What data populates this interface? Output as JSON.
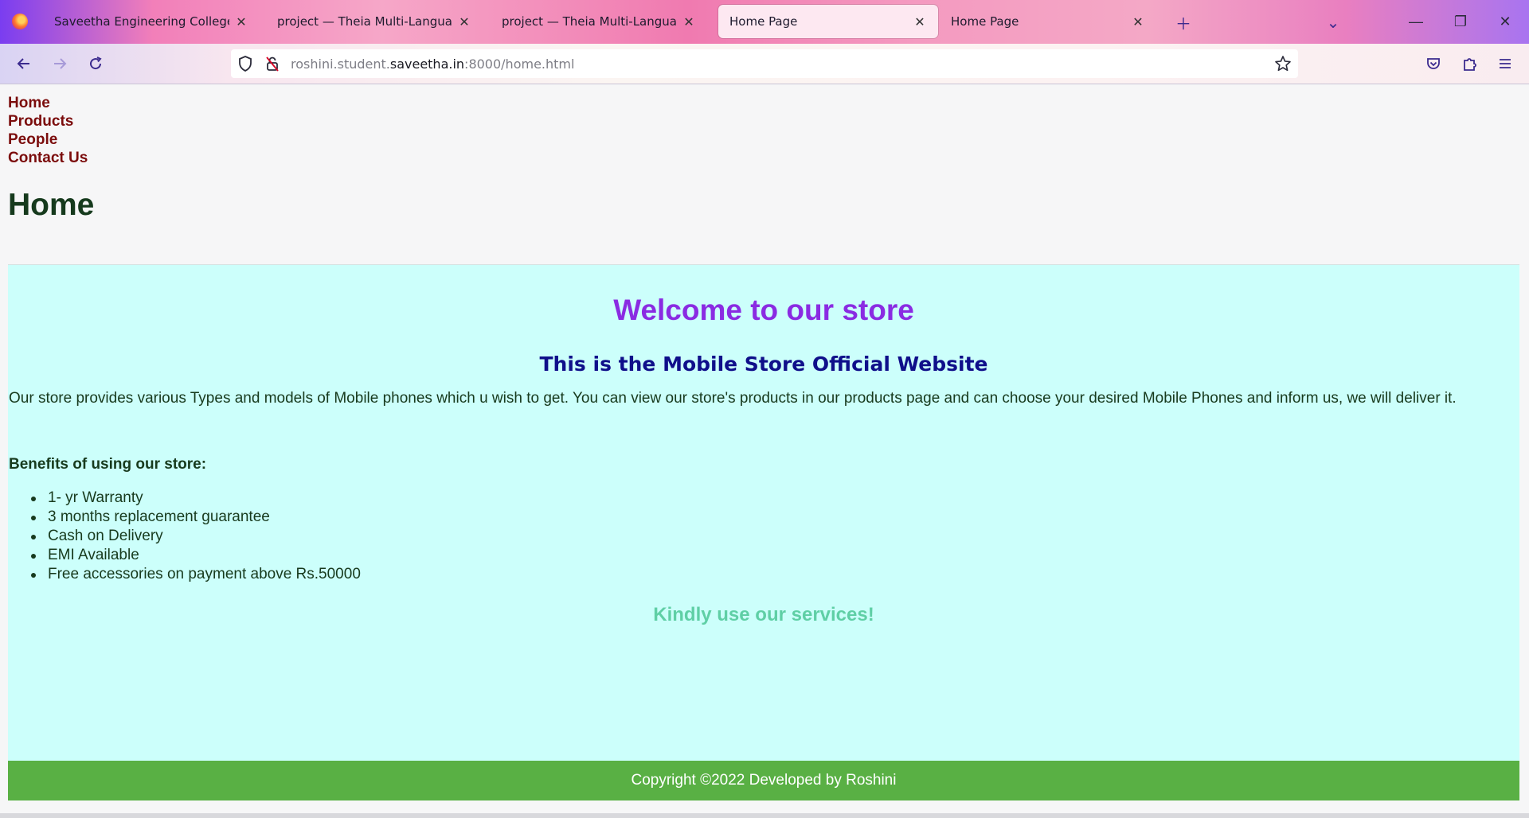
{
  "browser": {
    "tabs": [
      {
        "label": "Saveetha Engineering College",
        "active": false
      },
      {
        "label": "project — Theia Multi-Language Ex",
        "active": false
      },
      {
        "label": "project — Theia Multi-Language Ex",
        "active": false
      },
      {
        "label": "Home Page",
        "active": true
      },
      {
        "label": "Home Page",
        "active": false
      }
    ],
    "url": {
      "prefix": "roshini.student.",
      "domain": "saveetha.in",
      "suffix": ":8000/home.html"
    }
  },
  "page": {
    "menu": [
      "Home",
      "Products",
      "People",
      "Contact Us"
    ],
    "heading": "Home",
    "welcome": "Welcome to our store",
    "subtitle": "This is the Mobile Store Official Website",
    "intro": "Our store provides various Types and models of Mobile phones which u wish to get. You can view our store's products in our products page and can choose your desired Mobile Phones and inform us, we will deliver it.",
    "benefits_title": "Benefits of using our store:",
    "benefits": [
      "1- yr Warranty",
      "3 months replacement guarantee",
      "Cash on Delivery",
      "EMI Available",
      "Free accessories on payment above Rs.50000"
    ],
    "closing": "Kindly use our services!",
    "footer": "Copyright ©2022 Developed by Roshini"
  },
  "colors": {
    "menu_link": "#7b0c0c",
    "heading": "#163a1d",
    "content_bg": "#ccfffb",
    "welcome": "#8a2be2",
    "subtitle": "#0f0f8a",
    "closing": "#5fcfa5",
    "footer_bg": "#59b044"
  }
}
